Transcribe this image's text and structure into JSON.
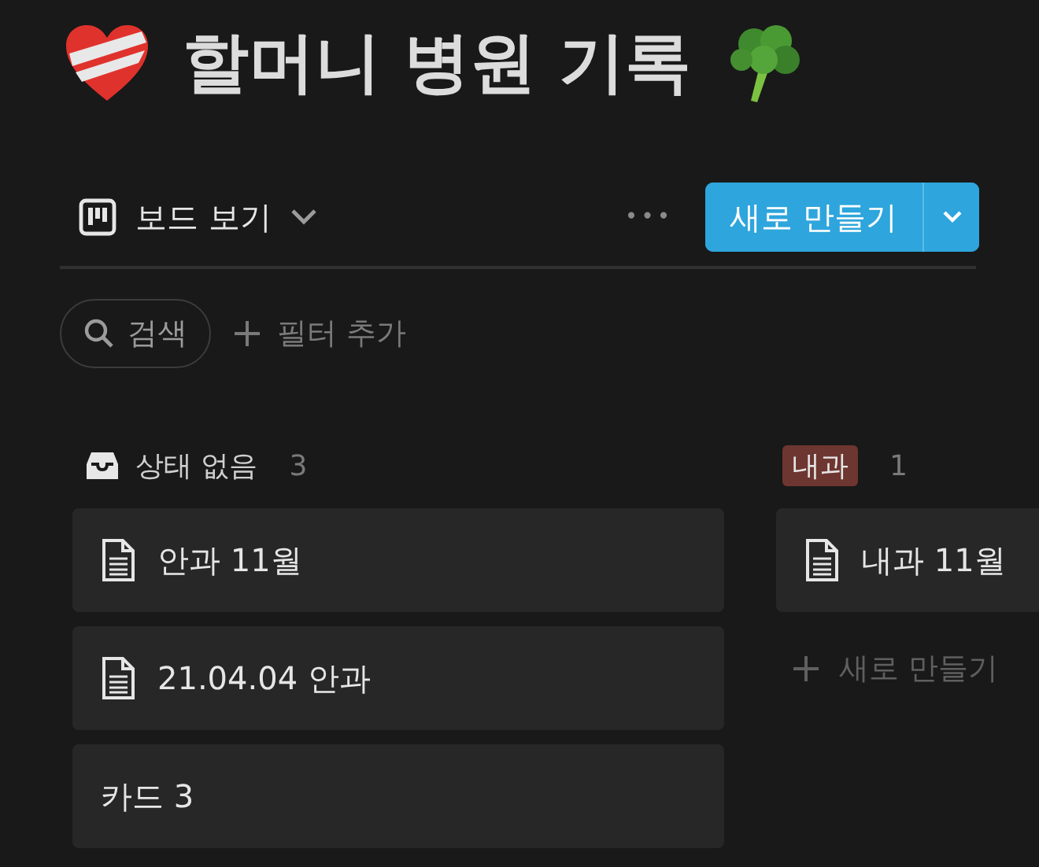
{
  "page": {
    "title": "할머니 병원 기록"
  },
  "toolbar": {
    "view": {
      "label": "보드 보기",
      "expanded": false
    },
    "more": "•••",
    "new_button": "새로 만들기"
  },
  "filters": {
    "search": "검색",
    "add_filter": "필터 추가"
  },
  "columns": [
    {
      "kind": "none",
      "label": "상태 없음",
      "count": "3",
      "cards": [
        {
          "kind": "page",
          "title": "안과 11월"
        },
        {
          "kind": "page",
          "title": "21.04.04 안과"
        },
        {
          "kind": "plain",
          "title": "카드 3"
        }
      ]
    },
    {
      "kind": "tag",
      "label": "내과",
      "color": "#6e3630",
      "count": "1",
      "cards": [
        {
          "kind": "page",
          "title": "내과 11월"
        }
      ],
      "new_label": "새로 만들기"
    }
  ]
}
